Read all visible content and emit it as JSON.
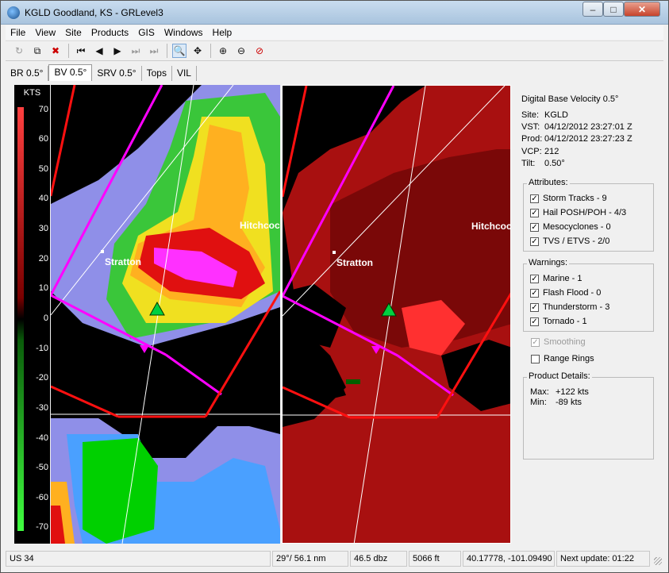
{
  "window": {
    "title": "KGLD Goodland, KS - GRLevel3"
  },
  "menu": [
    "File",
    "View",
    "Site",
    "Products",
    "GIS",
    "Windows",
    "Help"
  ],
  "toolbar_icons": [
    "loop-icon",
    "copy-icon",
    "delete-icon",
    "first-frame-icon",
    "prev-frame-icon",
    "play-icon",
    "next-frame-icon",
    "last-frame-icon",
    "zoom-icon",
    "pan-icon",
    "zoom-in-icon",
    "zoom-out-icon",
    "zoom-reset-icon"
  ],
  "tabs": [
    {
      "label": "BR 0.5°",
      "active": false
    },
    {
      "label": "BV 0.5°",
      "active": true
    },
    {
      "label": "SRV 0.5°",
      "active": false
    },
    {
      "label": "Tops",
      "active": false
    },
    {
      "label": "VIL",
      "active": false
    }
  ],
  "legend": {
    "unit": "KTS",
    "ticks": [
      "70",
      "60",
      "50",
      "40",
      "30",
      "20",
      "10",
      "0",
      "-10",
      "-20",
      "-30",
      "-40",
      "-50",
      "-60",
      "-70"
    ]
  },
  "map_labels": {
    "city1": "Stratton",
    "city2": "Hitchcock"
  },
  "info": {
    "product": "Digital Base Velocity 0.5°",
    "site_label": "Site:",
    "site": "KGLD",
    "vst_label": "VST:",
    "vst": "04/12/2012  23:27:01 Z",
    "prod_label": "Prod:",
    "prod": "04/12/2012  23:27:23 Z",
    "vcp_label": "VCP:",
    "vcp": "212",
    "tilt_label": "Tilt:",
    "tilt": "0.50°"
  },
  "attributes": {
    "title": "Attributes:",
    "items": [
      "Storm Tracks - 9",
      "Hail POSH/POH - 4/3",
      "Mesocyclones - 0",
      "TVS / ETVS - 2/0"
    ]
  },
  "warnings": {
    "title": "Warnings:",
    "items": [
      "Marine - 1",
      "Flash Flood - 0",
      "Thunderstorm - 3",
      "Tornado - 1"
    ]
  },
  "options": {
    "smoothing": "Smoothing",
    "range_rings": "Range Rings"
  },
  "product_details": {
    "title": "Product Details:",
    "max_label": "Max:",
    "max": "+122 kts",
    "min_label": "Min:",
    "min": "-89 kts"
  },
  "status": {
    "road": "US 34",
    "azimuth_range": "29°/ 56.1 nm",
    "dbz": "46.5 dbz",
    "height": "5066 ft",
    "latlon": "40.17778, -101.09490",
    "next_update": "Next update: 01:22"
  }
}
